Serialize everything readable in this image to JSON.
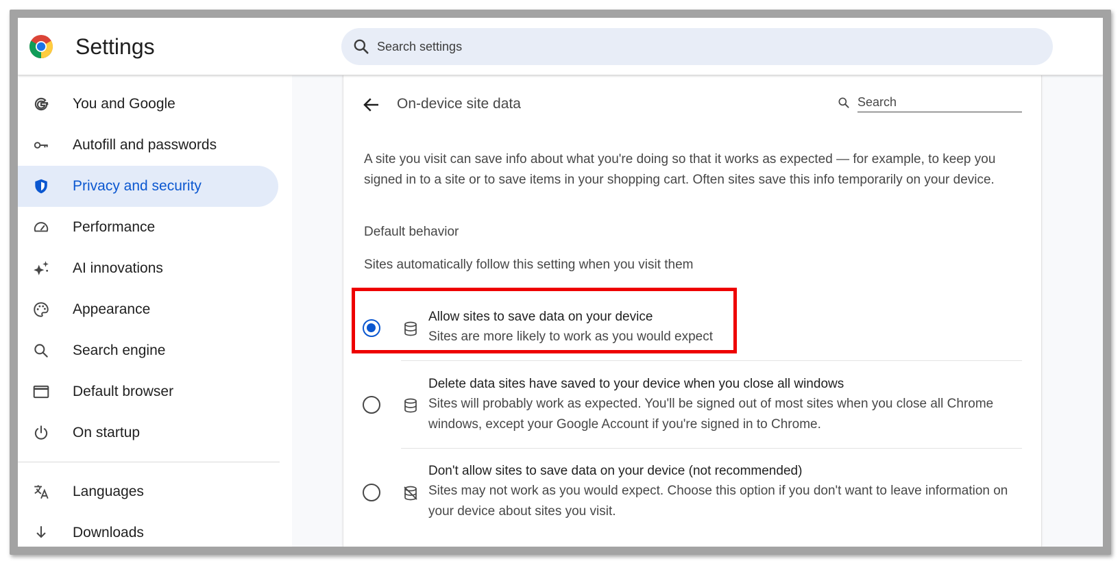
{
  "header": {
    "title": "Settings",
    "search_placeholder": "Search settings"
  },
  "sidebar": {
    "items": [
      {
        "label": "You and Google",
        "icon": "google-g-icon"
      },
      {
        "label": "Autofill and passwords",
        "icon": "key-icon"
      },
      {
        "label": "Privacy and security",
        "icon": "shield-icon",
        "active": true
      },
      {
        "label": "Performance",
        "icon": "speedometer-icon"
      },
      {
        "label": "AI innovations",
        "icon": "sparkle-icon"
      },
      {
        "label": "Appearance",
        "icon": "palette-icon"
      },
      {
        "label": "Search engine",
        "icon": "search-icon"
      },
      {
        "label": "Default browser",
        "icon": "browser-window-icon"
      },
      {
        "label": "On startup",
        "icon": "power-icon"
      },
      {
        "label": "Languages",
        "icon": "translate-icon"
      },
      {
        "label": "Downloads",
        "icon": "download-icon"
      }
    ]
  },
  "page": {
    "title": "On-device site data",
    "search_placeholder": "Search",
    "description": "A site you visit can save info about what you're doing so that it works as expected — for example, to keep you signed in to a site or to save items in your shopping cart. Often sites save this info temporarily on your device.",
    "section_title": "Default behavior",
    "section_subtitle": "Sites automatically follow this setting when you visit them",
    "options": [
      {
        "label": "Allow sites to save data on your device",
        "description": "Sites are more likely to work as you would expect",
        "icon": "database-icon",
        "selected": true
      },
      {
        "label": "Delete data sites have saved to your device when you close all windows",
        "description": "Sites will probably work as expected. You'll be signed out of most sites when you close all Chrome windows, except your Google Account if you're signed in to Chrome.",
        "icon": "database-icon",
        "selected": false
      },
      {
        "label": "Don't allow sites to save data on your device (not recommended)",
        "description": "Sites may not work as you would expect. Choose this option if you don't want to leave information on your device about sites you visit.",
        "icon": "database-off-icon",
        "selected": false
      }
    ]
  },
  "colors": {
    "accent": "#0b57d0",
    "active_nav_bg": "#e3ebf9",
    "highlight_border": "#ee0000"
  }
}
